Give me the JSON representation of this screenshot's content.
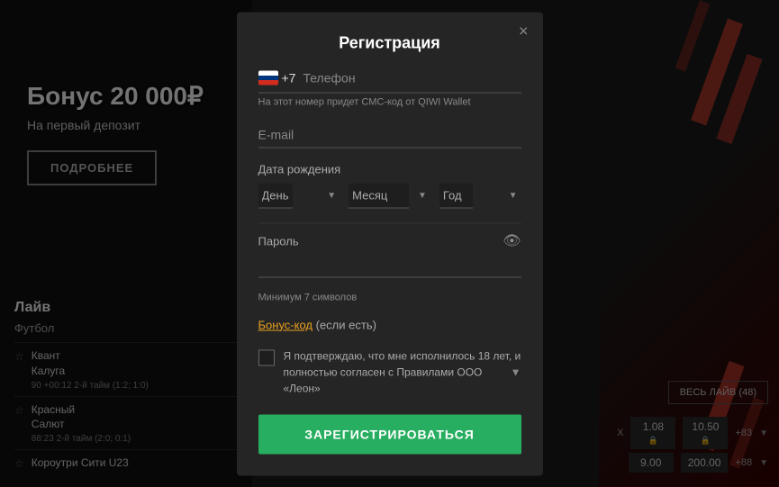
{
  "background": {
    "color": "#1c1c1c"
  },
  "left_panel": {
    "bonus_title": "Бонус 20 000₽",
    "bonus_subtitle": "На первый депозит",
    "details_button": "ПОДРОБНЕЕ"
  },
  "live_section": {
    "title": "Лайв",
    "sport": "Футбол",
    "matches": [
      {
        "team1": "Квант",
        "team2": "Калуга",
        "time": "90 +00:12 2-й тайм (1:2; 1:0)"
      },
      {
        "team1": "Красный",
        "team2": "Салют",
        "time": "88:23 2-й тайм (2:0; 0:1)"
      },
      {
        "team1": "Короутри Сити U23",
        "team2": "",
        "time": ""
      }
    ]
  },
  "right_panel": {
    "live_all_button": "ВЕСЬ ЛАЙВ (48)",
    "x_label": "X",
    "score1": "1.08",
    "score2": "10.50",
    "plus1": "+83",
    "score3": "9.00",
    "score4": "200.00",
    "plus2": "+88"
  },
  "modal": {
    "title": "Регистрация",
    "close_label": "×",
    "phone_section": {
      "country_code": "+7",
      "placeholder": "Телефон",
      "sms_note": "На этот номер придет СМС-код от QIWI Wallet"
    },
    "email_label": "E-mail",
    "birth_section": {
      "label": "Дата рождения",
      "day_placeholder": "День",
      "month_placeholder": "Месяц",
      "year_placeholder": "Год"
    },
    "password_section": {
      "label": "Пароль",
      "note": "Минимум 7 символов"
    },
    "bonus_code": {
      "link_text": "Бонус-код",
      "note_text": " (если есть)"
    },
    "checkbox_text": "Я подтверждаю, что мне исполнилось 18 лет, и полностью согласен с Правилами ООО «Леон»",
    "register_button": "ЗАРЕГИСТРИРОВАТЬСЯ"
  }
}
